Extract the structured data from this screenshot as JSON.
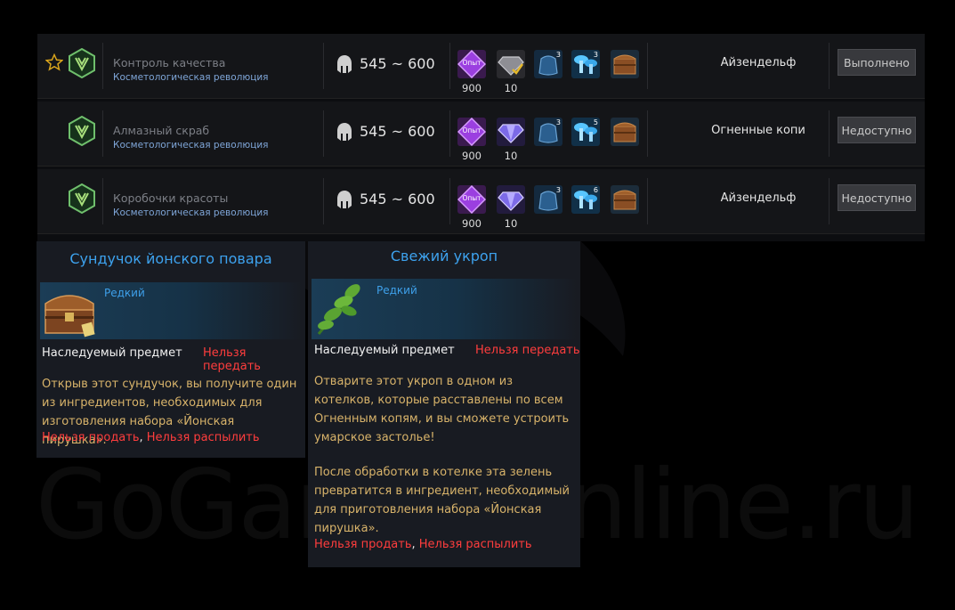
{
  "watermark": "GoGamesOnline.ru",
  "quests": [
    {
      "name": "Контроль качества",
      "category": "Косметологическая революция",
      "level": "545 ~ 600",
      "exp_label": "Опыт",
      "exp": "900",
      "shards": "10",
      "bag_count": "3",
      "mushroom_count": "3",
      "location": "Айзендельф",
      "status_button": "Выполнено",
      "favorite": true
    },
    {
      "name": "Алмазный скраб",
      "category": "Косметологическая революция",
      "level": "545 ~ 600",
      "exp_label": "Опыт",
      "exp": "900",
      "shards": "10",
      "bag_count": "3",
      "mushroom_count": "5",
      "location": "Огненные копи",
      "status_button": "Недоступно",
      "favorite": false
    },
    {
      "name": "Коробочки красоты",
      "category": "Косметологическая революция",
      "level": "545 ~ 600",
      "exp_label": "Опыт",
      "exp": "900",
      "shards": "10",
      "bag_count": "3",
      "mushroom_count": "6",
      "location": "Айзендельф",
      "status_button": "Недоступно",
      "favorite": false
    }
  ],
  "tooltip_chest": {
    "title": "Сундучок йонского повара",
    "rarity": "Редкий",
    "type": "Наследуемый предмет",
    "no_trade": "Нельзя передать",
    "description": "Открыв этот сундучок, вы получите один из ингредиентов, необходимых для изготовления набора «Йонская пирушка».",
    "no_sell": "Нельзя продать",
    "separator": ", ",
    "no_dismantle": "Нельзя распылить"
  },
  "tooltip_dill": {
    "title": "Свежий укроп",
    "rarity": "Редкий",
    "type": "Наследуемый предмет",
    "no_trade": "Нельзя передать",
    "description": "Отварите этот укроп в одном из котелков, которые расставлены по всем Огненным копям, и вы сможете устроить умарское застолье!",
    "description2": "После обработки в котелке эта зелень превратится в ингредиент, необходимый для приготовления набора «Йонская пирушка».",
    "no_sell": "Нельзя продать",
    "separator": ", ",
    "no_dismantle": "Нельзя распылить"
  },
  "colors": {
    "rarity_blue": "#3ea0ea",
    "warning_red": "#ff3d3d",
    "description_gold": "#d8b36a"
  }
}
